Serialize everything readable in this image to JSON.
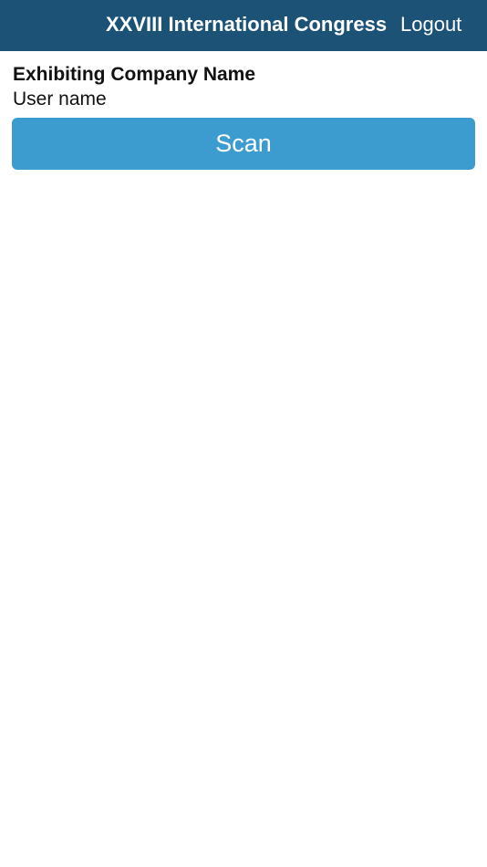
{
  "header": {
    "title": "XXVIII International Congress",
    "logout_label": "Logout"
  },
  "main": {
    "company_name": "Exhibiting Company Name",
    "user_name": "User name",
    "scan_label": "Scan"
  },
  "colors": {
    "header_background": "#1b5275",
    "scan_button_background": "#3d9ccf",
    "text_primary": "#111111",
    "text_on_dark": "#ffffff"
  }
}
